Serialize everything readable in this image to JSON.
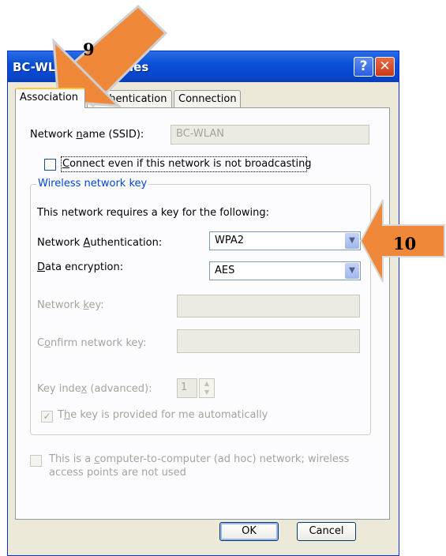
{
  "window": {
    "title": "BC-WLAN Properties",
    "help_glyph": "?",
    "close_glyph": "✕"
  },
  "tabs": [
    {
      "label": "Association",
      "active": true
    },
    {
      "label": "Authentication",
      "active": false
    },
    {
      "label": "Connection",
      "active": false
    }
  ],
  "association": {
    "ssid_label_pre": "Network ",
    "ssid_label_key": "n",
    "ssid_label_post": "ame (SSID):",
    "ssid_value": "BC-WLAN",
    "connect_label_key": "C",
    "connect_label_post": "onnect even if this network is not broadcasting",
    "connect_checked": false,
    "group_title": "Wireless network key",
    "key_intro": "This network requires a key for the following:",
    "auth_label_pre": "Network ",
    "auth_label_key": "A",
    "auth_label_post": "uthentication:",
    "auth_value": "WPA2",
    "enc_label_key": "D",
    "enc_label_post": "ata encryption:",
    "enc_value": "AES",
    "network_key_label_pre": "Network ",
    "network_key_label_key": "k",
    "network_key_label_post": "ey:",
    "confirm_label_pre": "C",
    "confirm_label_key": "o",
    "confirm_label_post": "nfirm network key:",
    "key_index_label_pre": "Key inde",
    "key_index_label_key": "x",
    "key_index_label_post": " (advanced):",
    "key_index_value": "1",
    "auto_key_pre": "T",
    "auto_key_key": "h",
    "auto_key_post": "e key is provided for me automatically",
    "auto_key_checked": true,
    "adhoc_line1_pre": "This is a ",
    "adhoc_line1_key": "c",
    "adhoc_line1_post": "omputer-to-computer (ad hoc) network; wireless",
    "adhoc_line2": "access points are not used",
    "adhoc_checked": false
  },
  "buttons": {
    "ok": "OK",
    "cancel": "Cancel"
  },
  "callouts": [
    {
      "number": "9",
      "color": "#f0883a"
    },
    {
      "number": "10",
      "color": "#f0883a"
    }
  ]
}
